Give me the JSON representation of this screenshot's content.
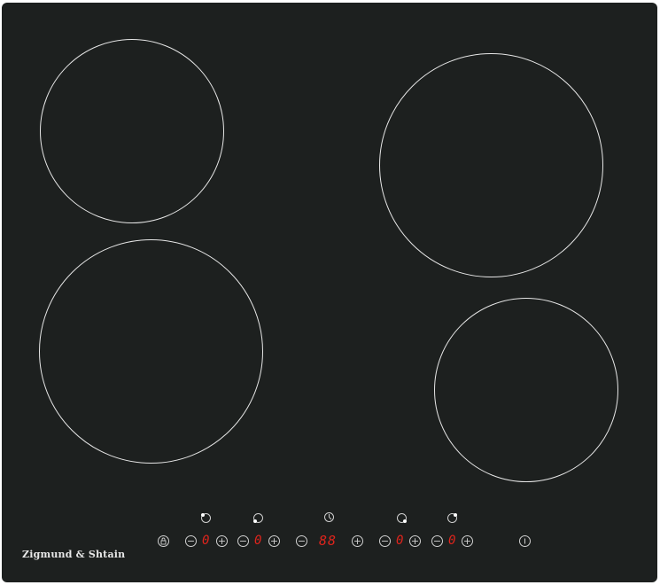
{
  "brand": {
    "name": "Zigmund & Shtain"
  },
  "zones": [
    {
      "id": "rear-left"
    },
    {
      "id": "front-left"
    },
    {
      "id": "rear-right"
    },
    {
      "id": "front-right"
    }
  ],
  "panel": {
    "lock_icon": "lock-icon",
    "zone_controls": [
      {
        "minus": "−",
        "display": "0",
        "plus": "+",
        "indicator": "rear-left"
      },
      {
        "minus": "−",
        "display": "0",
        "plus": "+",
        "indicator": "front-left"
      },
      {
        "minus": "−",
        "display": "0",
        "plus": "+",
        "indicator": "front-right"
      },
      {
        "minus": "−",
        "display": "0",
        "plus": "+",
        "indicator": "rear-right"
      }
    ],
    "timer": {
      "minus": "−",
      "display": "88",
      "plus": "+",
      "icon": "clock-icon"
    },
    "power_icon": "power-icon",
    "display_color": "#e0241c"
  }
}
